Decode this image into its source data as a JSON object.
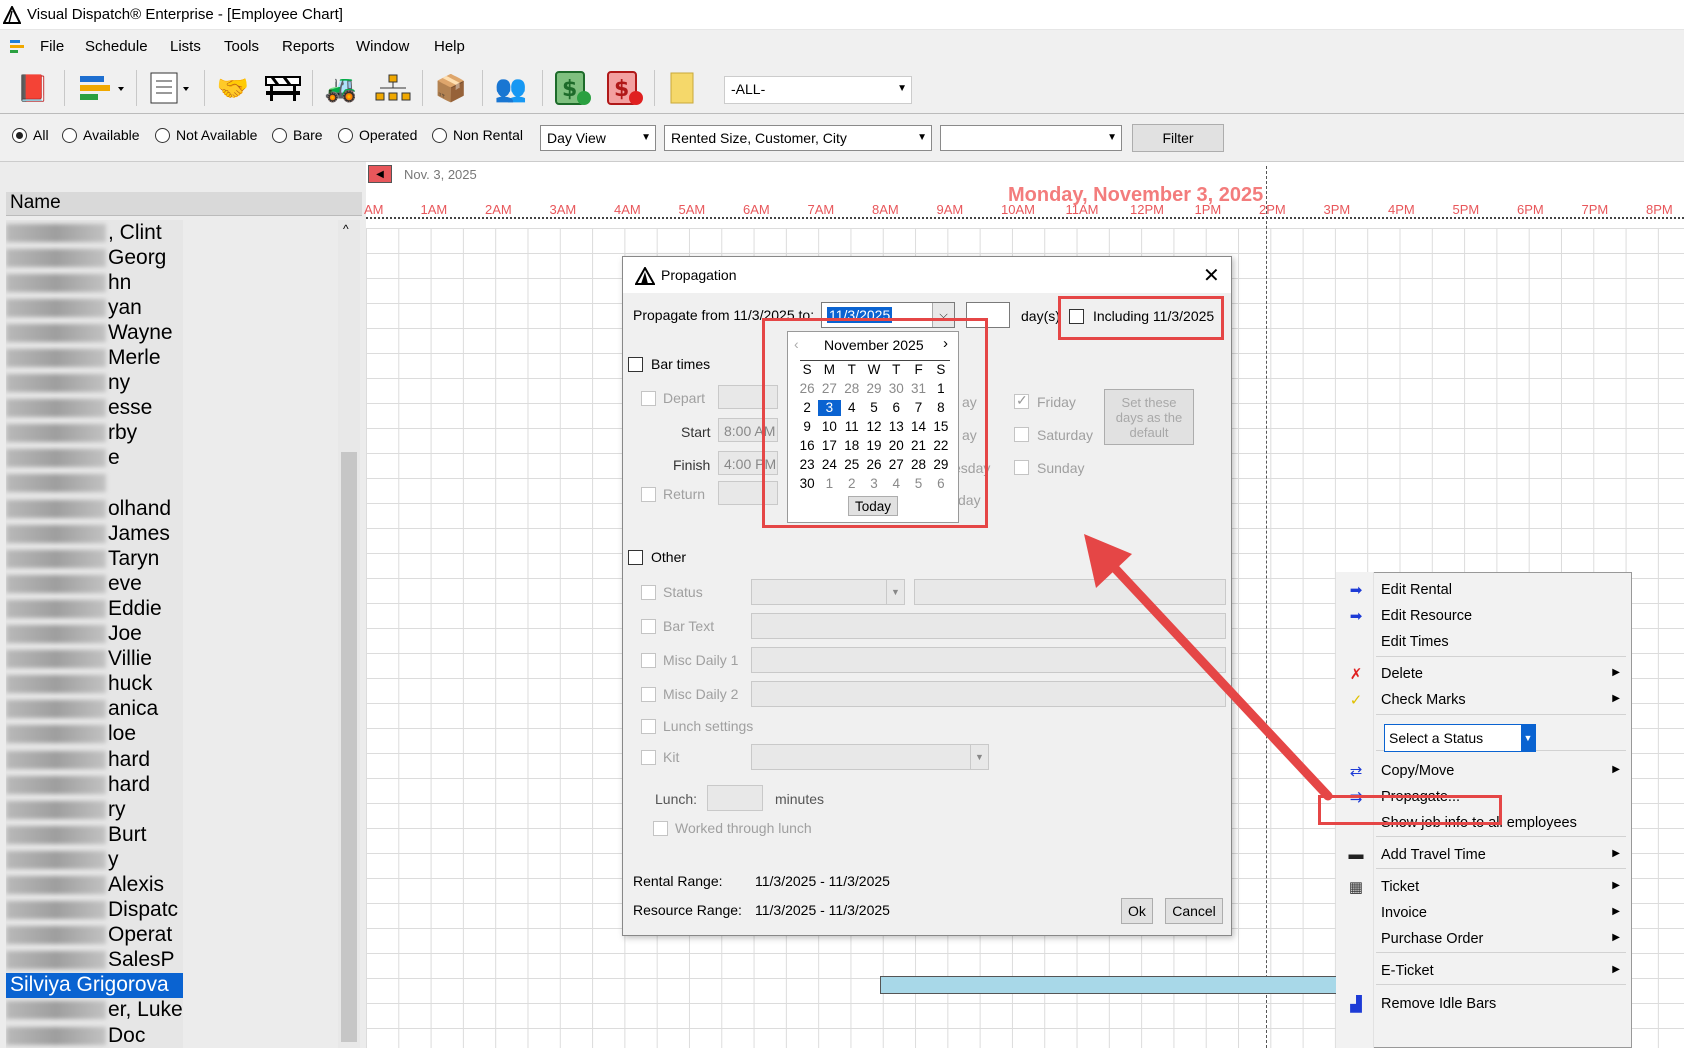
{
  "window": {
    "title": "Visual Dispatch® Enterprise - [Employee Chart]"
  },
  "menu": [
    "File",
    "Schedule",
    "Lists",
    "Tools",
    "Reports",
    "Window",
    "Help"
  ],
  "toolbar": {
    "filter_combo": "-ALL-"
  },
  "filterbar": {
    "radios": [
      "All",
      "Available",
      "Not Available",
      "Bare",
      "Operated",
      "Non Rental"
    ],
    "selected": "All",
    "view_combo": "Day View",
    "sort_combo": "Rented Size, Customer, City",
    "extra_combo": "",
    "filter_button": "Filter"
  },
  "names": {
    "header": "Name",
    "rows": [
      ", Clint",
      "Georg",
      "hn",
      "yan",
      "Wayne",
      "Merle",
      "ny",
      "esse",
      "rby",
      "e",
      "",
      "olhand",
      "James",
      "Taryn",
      "eve",
      "Eddie",
      "Joe",
      "Villie",
      "huck",
      "anica",
      "loe",
      "hard",
      "hard",
      "ry",
      "Burt",
      "y",
      "Alexis",
      "Dispatc",
      "Operat",
      "SalesP",
      "Silviya Grigorova",
      "er, Luke",
      "Doc"
    ],
    "selected_row": "Silviya Grigorova"
  },
  "chart": {
    "nav_date": "Nov. 3, 2025",
    "title_date": "Monday, November 3, 2025",
    "hours": [
      "AM",
      "1AM",
      "2AM",
      "3AM",
      "4AM",
      "5AM",
      "6AM",
      "7AM",
      "8AM",
      "9AM",
      "10AM",
      "11AM",
      "12PM",
      "1PM",
      "2PM",
      "3PM",
      "4PM",
      "5PM",
      "6PM",
      "7PM",
      "8PM"
    ]
  },
  "dialog": {
    "title": "Propagation",
    "propagate_label": "Propagate from 11/3/2025 to:",
    "propagate_to": "11/3/2025",
    "days_value": "",
    "days_label": "day(s)",
    "including_label": "Including 11/3/2025",
    "bar_times_label": "Bar times",
    "depart_label": "Depart",
    "start_label": "Start",
    "start_value": "8:00 AM",
    "finish_label": "Finish",
    "finish_value": "4:00 PM",
    "return_label": "Return",
    "partial_day_1": "ay",
    "partial_day_2": "ay",
    "partial_day_3": "esday",
    "partial_day_4": "day",
    "friday_label": "Friday",
    "saturday_label": "Saturday",
    "sunday_label": "Sunday",
    "set_default_button": "Set these days as the default",
    "other_label": "Other",
    "status_label": "Status",
    "bar_text_label": "Bar Text",
    "misc1_label": "Misc Daily 1",
    "misc2_label": "Misc Daily 2",
    "lunch_settings_label": "Lunch settings",
    "kit_label": "Kit",
    "lunch_label": "Lunch:",
    "minutes_label": "minutes",
    "worked_lunch_label": "Worked through lunch",
    "rental_range_label": "Rental Range:",
    "rental_range_value": "11/3/2025 - 11/3/2025",
    "resource_range_label": "Resource Range:",
    "resource_range_value": "11/3/2025 - 11/3/2025",
    "ok_button": "Ok",
    "cancel_button": "Cancel"
  },
  "calendar": {
    "month": "November 2025",
    "weekdays": [
      "S",
      "M",
      "T",
      "W",
      "T",
      "F",
      "S"
    ],
    "days": [
      [
        "26",
        "27",
        "28",
        "29",
        "30",
        "31",
        "1"
      ],
      [
        "2",
        "3",
        "4",
        "5",
        "6",
        "7",
        "8"
      ],
      [
        "9",
        "10",
        "11",
        "12",
        "13",
        "14",
        "15"
      ],
      [
        "16",
        "17",
        "18",
        "19",
        "20",
        "21",
        "22"
      ],
      [
        "23",
        "24",
        "25",
        "26",
        "27",
        "28",
        "29"
      ],
      [
        "30",
        "1",
        "2",
        "3",
        "4",
        "5",
        "6"
      ]
    ],
    "selected_day": "3",
    "today_button": "Today"
  },
  "context_menu": {
    "items": [
      {
        "label": "Edit Rental",
        "icon": "right-arrow-icon",
        "submenu": false
      },
      {
        "label": "Edit Resource",
        "icon": "right-arrow-icon",
        "submenu": false
      },
      {
        "label": "Edit Times",
        "icon": "",
        "submenu": false
      },
      {
        "label": "Delete",
        "icon": "delete-x-icon",
        "submenu": true
      },
      {
        "label": "Check Marks",
        "icon": "checkmark-icon",
        "submenu": true
      },
      {
        "label": "Select a Status",
        "icon": "",
        "submenu": false
      },
      {
        "label": "Copy/Move",
        "icon": "copy-move-icon",
        "submenu": true
      },
      {
        "label": "Propagate...",
        "icon": "propagate-icon",
        "submenu": false
      },
      {
        "label": "Show job info to all employees",
        "icon": "",
        "submenu": false
      },
      {
        "label": "Add Travel Time",
        "icon": "travel-time-icon",
        "submenu": true
      },
      {
        "label": "Ticket",
        "icon": "ticket-icon",
        "submenu": true
      },
      {
        "label": "Invoice",
        "icon": "",
        "submenu": true
      },
      {
        "label": "Purchase Order",
        "icon": "",
        "submenu": true
      },
      {
        "label": "E-Ticket",
        "icon": "",
        "submenu": true
      },
      {
        "label": "Remove Idle Bars",
        "icon": "idle-bars-icon",
        "submenu": false
      }
    ]
  },
  "colors": {
    "accent": "#0a63d1",
    "highlight_red": "#e54646",
    "chart_title": "#f37c7c",
    "bar_fill": "#a8d8e8"
  }
}
